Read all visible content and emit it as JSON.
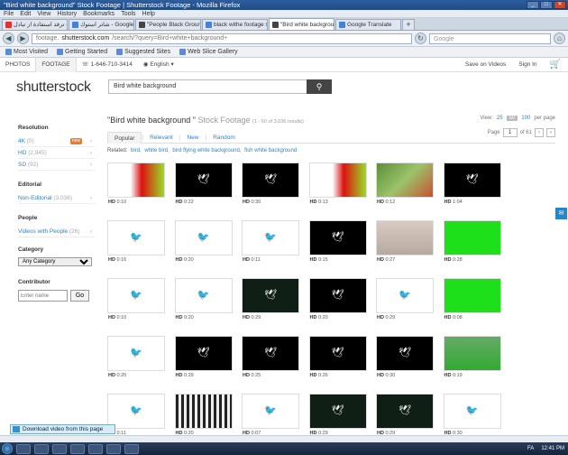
{
  "window": {
    "title": "\"Bird white background\" Stock Footage | Shutterstock Footage - Mozilla Firefox",
    "controls": [
      "_",
      "□",
      "✕"
    ]
  },
  "menu": [
    "File",
    "Edit",
    "View",
    "History",
    "Bookmarks",
    "Tools",
    "Help"
  ],
  "tabs": [
    {
      "label": "الجمن ويندوز الكت - ترفد استفادة از تبادل",
      "icon": "red"
    },
    {
      "label": "شاتر استوك - Google Se...",
      "icon": "google"
    },
    {
      "label": "\"People Black Ground ...",
      "icon": "stock"
    },
    {
      "label": "black withe footage shu...",
      "icon": "google"
    },
    {
      "label": "\"Bird white background...",
      "icon": "stock",
      "active": true
    },
    {
      "label": "Google Translate",
      "icon": "google"
    }
  ],
  "nav": {
    "url_prefix": "footage.",
    "url_domain": "shutterstock.com",
    "url_rest": "/search/?query=Bird+white+background+",
    "search_placeholder": "Google"
  },
  "bookmarks": [
    "Most Visited",
    "Getting Started",
    "Suggested Sites",
    "Web Slice Gallery"
  ],
  "site": {
    "tabs": [
      "PHOTOS",
      "FOOTAGE"
    ],
    "phone": "1-646-710-3414",
    "language": "English",
    "save_on_videos": "Save on Videos",
    "sign_in": "Sign In",
    "logo": "shutterstock",
    "search_value": "Bird white background"
  },
  "filters": {
    "resolution_label": "Resolution",
    "resolution": [
      {
        "name": "4K",
        "count": "(0)",
        "badge": "new"
      },
      {
        "name": "HD",
        "count": "(2,945)"
      },
      {
        "name": "SD",
        "count": "(92)"
      }
    ],
    "editorial_label": "Editorial",
    "non_editorial": "Non-Editorial",
    "non_editorial_count": "(3,036)",
    "people_label": "People",
    "videos_people": "Videos with People",
    "videos_people_count": "(26)",
    "category_label": "Category",
    "category_value": "Any Category",
    "contributor_label": "Contributor",
    "contributor_placeholder": "Enter name",
    "go": "Go"
  },
  "results": {
    "title": "\"Bird white background \"",
    "title_sub": "Stock Footage",
    "count": "(1 - 50 of 3,036 results)",
    "view_label": "View:",
    "view_options": [
      "25",
      "50",
      "100"
    ],
    "per_page": "per page",
    "sort": [
      "Popular",
      "Relevant",
      "New",
      "Random"
    ],
    "page_label": "Page",
    "page_value": "1",
    "page_of": "of 61",
    "related_label": "Related:",
    "related": [
      "bird,",
      "white bird,",
      "bird flying white background,",
      "fish white background"
    ]
  },
  "clips": [
    {
      "q": "HD",
      "t": "0:10",
      "style": "red"
    },
    {
      "q": "HD",
      "t": "0:22",
      "style": "black"
    },
    {
      "q": "HD",
      "t": "0:30",
      "style": "black"
    },
    {
      "q": "HD",
      "t": "0:13",
      "style": "red"
    },
    {
      "q": "HD",
      "t": "0:12",
      "style": "flower"
    },
    {
      "q": "HD",
      "t": "1:04",
      "style": "black"
    },
    {
      "q": "HD",
      "t": "0:16",
      "style": "white"
    },
    {
      "q": "HD",
      "t": "0:20",
      "style": "white"
    },
    {
      "q": "HD",
      "t": "0:11",
      "style": "white"
    },
    {
      "q": "HD",
      "t": "0:15",
      "style": "black"
    },
    {
      "q": "HD",
      "t": "0:27",
      "style": "sky"
    },
    {
      "q": "HD",
      "t": "0:28",
      "style": "green"
    },
    {
      "q": "HD",
      "t": "0:10",
      "style": "white"
    },
    {
      "q": "HD",
      "t": "0:20",
      "style": "white"
    },
    {
      "q": "HD",
      "t": "0:29",
      "style": "dkgreen"
    },
    {
      "q": "HD",
      "t": "0:20",
      "style": "black"
    },
    {
      "q": "HD",
      "t": "0:29",
      "style": "white"
    },
    {
      "q": "HD",
      "t": "0:08",
      "style": "green"
    },
    {
      "q": "HD",
      "t": "0:20",
      "style": "white"
    },
    {
      "q": "HD",
      "t": "0:29",
      "style": "black"
    },
    {
      "q": "HD",
      "t": "0:25",
      "style": "black"
    },
    {
      "q": "HD",
      "t": "0:26",
      "style": "black"
    },
    {
      "q": "HD",
      "t": "0:30",
      "style": "black"
    },
    {
      "q": "HD",
      "t": "0:19",
      "style": "peacock"
    },
    {
      "q": "HD",
      "t": "0:11",
      "style": "white"
    },
    {
      "q": "HD",
      "t": "0:20",
      "style": "zebra"
    },
    {
      "q": "HD",
      "t": "0:07",
      "style": "white"
    },
    {
      "q": "HD",
      "t": "0:29",
      "style": "dkgreen"
    },
    {
      "q": "HD",
      "t": "0:29",
      "style": "dkgreen"
    },
    {
      "q": "HD",
      "t": "0:30",
      "style": "white"
    }
  ],
  "download_bar": "Download video from this page",
  "taskbar": {
    "lang": "FA",
    "time": "12:41 PM"
  }
}
